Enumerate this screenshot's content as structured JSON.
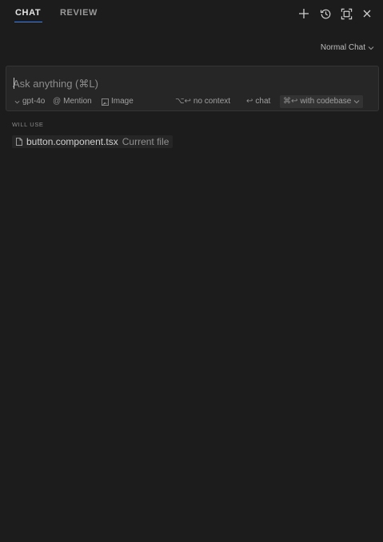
{
  "tabs": [
    {
      "label": "CHAT",
      "active": true
    },
    {
      "label": "REVIEW",
      "active": false
    }
  ],
  "header_icons": [
    "plus-icon",
    "history-icon",
    "maximize-icon",
    "close-icon"
  ],
  "mode": {
    "label": "Normal Chat"
  },
  "composer": {
    "placeholder": "Ask anything (⌘L)",
    "value": "",
    "model": "gpt-4o",
    "mention": "Mention",
    "image": "Image",
    "no_context": {
      "shortcut": "⌥↩",
      "label": "no context"
    },
    "chat": {
      "shortcut": "↩",
      "label": "chat"
    },
    "codebase": {
      "shortcut": "⌘↩",
      "label": "with codebase"
    }
  },
  "will_use": {
    "heading": "WILL USE",
    "file": "button.component.tsx",
    "note": "Current file"
  },
  "colors": {
    "background": "#1c1c1c",
    "input_background": "#262626",
    "accent": "#3b82f6"
  }
}
